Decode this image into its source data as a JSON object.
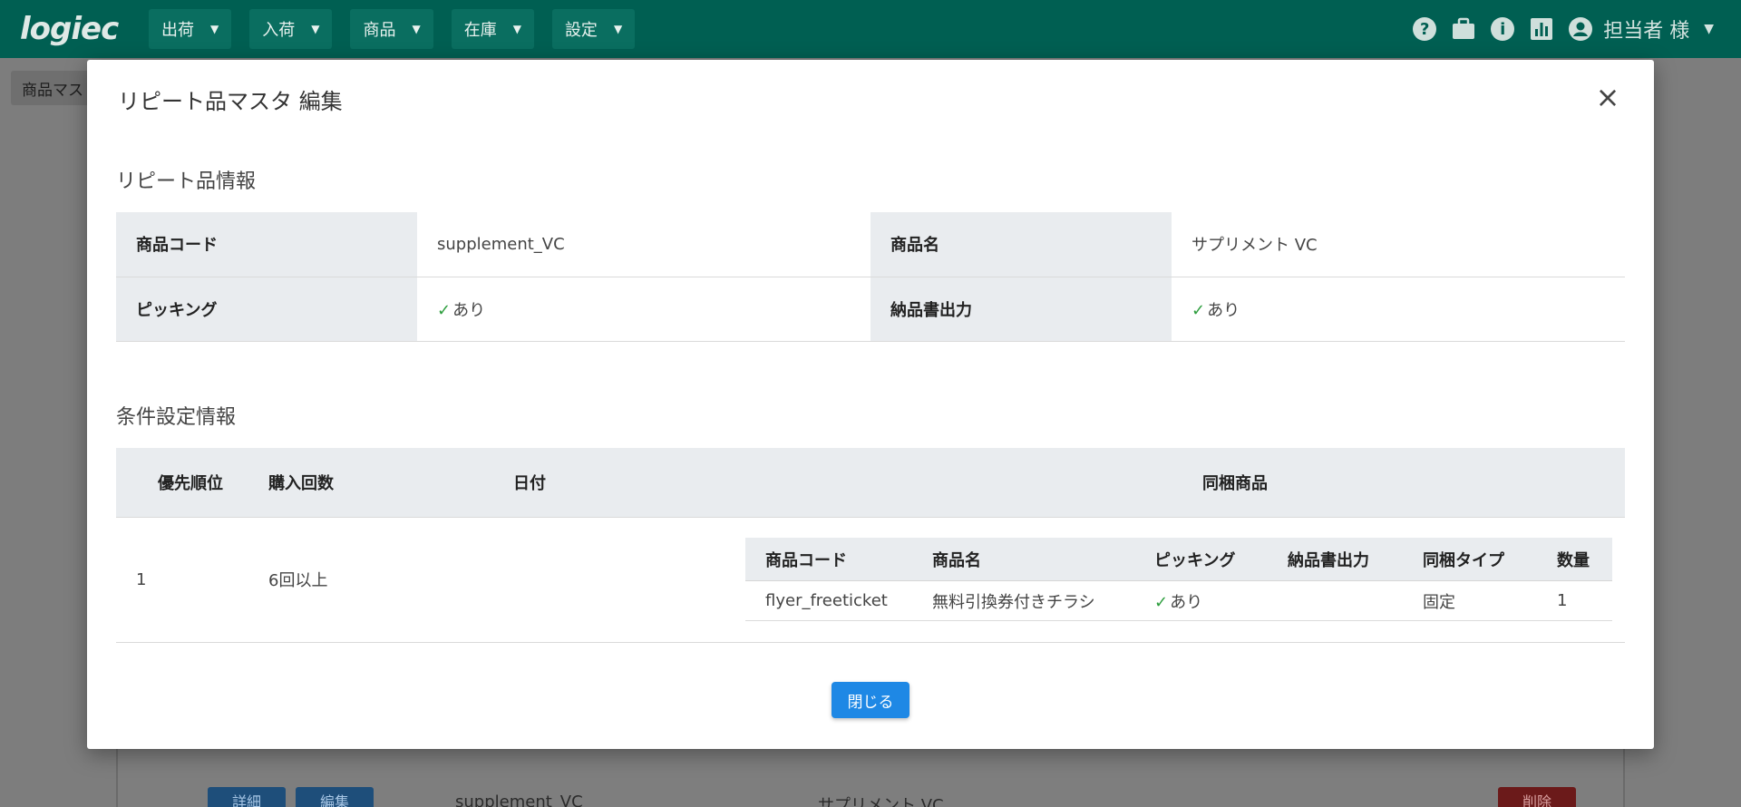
{
  "app": {
    "logo": "logiec"
  },
  "nav": {
    "menus": [
      {
        "label": "出荷"
      },
      {
        "label": "入荷"
      },
      {
        "label": "商品"
      },
      {
        "label": "在庫"
      },
      {
        "label": "設定"
      }
    ],
    "user": "担当者 様",
    "icons": [
      "help-icon",
      "briefcase-icon",
      "info-icon",
      "chart-icon",
      "account-icon"
    ]
  },
  "background": {
    "breadcrumb": "商品マス",
    "row": {
      "detail_button": "詳細",
      "edit_button": "編集",
      "code": "supplement_VC",
      "name": "サプリメント VC",
      "delete_button": "削除"
    }
  },
  "modal": {
    "title": "リピート品マスタ 編集",
    "close_glyph": "×",
    "section_info": "リピート品情報",
    "info": {
      "code_label": "商品コード",
      "code_value": "supplement_VC",
      "name_label": "商品名",
      "name_value": "サプリメント VC",
      "picking_label": "ピッキング",
      "picking_value": "あり",
      "delivery_label": "納品書出力",
      "delivery_value": "あり"
    },
    "section_conditions": "条件設定情報",
    "conditions_headers": {
      "priority": "優先順位",
      "count": "購入回数",
      "date": "日付",
      "bundle": "同梱商品"
    },
    "conditions_rows": [
      {
        "priority": "1",
        "count": "6回以上",
        "date": "",
        "bundle_headers": {
          "code": "商品コード",
          "name": "商品名",
          "picking": "ピッキング",
          "delivery": "納品書出力",
          "type": "同梱タイプ",
          "qty": "数量"
        },
        "bundle_items": [
          {
            "code": "flyer_freeticket",
            "name": "無料引換券付きチラシ",
            "picking": "あり",
            "delivery": "",
            "type": "固定",
            "qty": "1"
          }
        ]
      }
    ],
    "close_button": "閉じる"
  },
  "colors": {
    "nav": "#005f52",
    "accent": "#1e88e5",
    "check": "#2e9e3e",
    "danger": "#c62828"
  }
}
